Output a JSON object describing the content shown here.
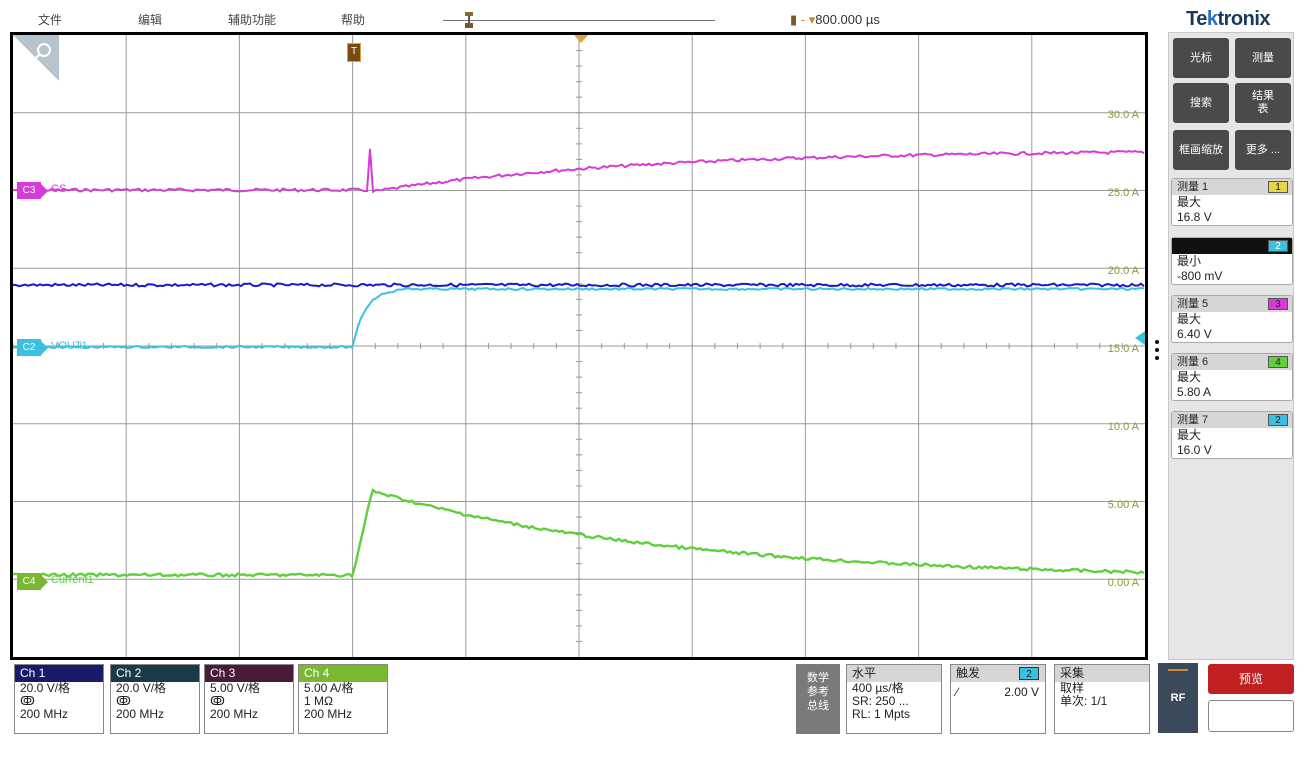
{
  "menu": {
    "file": "文件",
    "edit": "编辑",
    "utility": "辅助功能",
    "help": "帮助"
  },
  "trigger_position": {
    "label": "800.000 µs"
  },
  "waveform": {
    "y_tick_labels": [
      "30.0 A",
      "25.0 A",
      "20.0 A",
      "15.0 A",
      "10.0 A",
      "5.00 A",
      "0.00 A"
    ],
    "trigger_marker": "T",
    "channels": [
      {
        "id": "C3",
        "name": "CS",
        "color": "#d63bd6"
      },
      {
        "id": "C2",
        "name": "VOUT1",
        "color": "#3cc0e0"
      },
      {
        "id": "C4",
        "name": "Current1",
        "color": "#5fcf3e"
      }
    ],
    "trace_colors": {
      "ch1": "#1a1acc",
      "ch2": "#3cc0e0",
      "ch3": "#d63bd6",
      "ch4": "#5fcf3e"
    }
  },
  "right_panel": {
    "logo_pre": "Te",
    "logo_k": "k",
    "logo_post": "tronix",
    "buttons": {
      "cursor": "光标",
      "measure": "测量",
      "search": "搜索",
      "results_table_1": "结果",
      "results_table_2": "表",
      "zoom": "框画缩放",
      "more": "更多 ..."
    },
    "measurements": [
      {
        "title": "测量 1",
        "src": "1",
        "kind": "最大",
        "value": "16.8 V",
        "src_color": "#e8d64a"
      },
      {
        "title": "",
        "src": "2",
        "kind": "最小",
        "value": "-800 mV",
        "src_color": "#3cc0e0"
      },
      {
        "title": "测量 5",
        "src": "3",
        "kind": "最大",
        "value": "6.40 V",
        "src_color": "#d63bd6"
      },
      {
        "title": "测量 6",
        "src": "4",
        "kind": "最大",
        "value": "5.80 A",
        "src_color": "#5fcf3e"
      },
      {
        "title": "测量 7",
        "src": "2",
        "kind": "最大",
        "value": "16.0 V",
        "src_color": "#3cc0e0"
      }
    ]
  },
  "bottom": {
    "channels": [
      {
        "label": "Ch 1",
        "scale": "20.0 V/格",
        "coupling": "ↂ",
        "bw": "200 MHz",
        "color": "#1a1a6a"
      },
      {
        "label": "Ch 2",
        "scale": "20.0 V/格",
        "coupling": "ↂ",
        "bw": "200 MHz",
        "color": "#1a3a4a"
      },
      {
        "label": "Ch 3",
        "scale": "5.00 V/格",
        "coupling": "ↂ",
        "bw": "200 MHz",
        "color": "#4a1a3a"
      },
      {
        "label": "Ch 4",
        "scale": "5.00 A/格",
        "coupling": "1 MΩ",
        "bw": "200 MHz",
        "color": "#7ab832"
      }
    ],
    "math_ref_bus": [
      "数学",
      "参考",
      "总线"
    ],
    "horizontal": {
      "title": "水平",
      "scale": "400 µs/格",
      "sr": "SR: 250 ...",
      "rl": "RL: 1 Mpts"
    },
    "trigger": {
      "title": "触发",
      "source": "2",
      "slope": "∕",
      "level": "2.00 V"
    },
    "acquire": {
      "title": "采集",
      "mode": "取样",
      "count": "单次: 1/1"
    },
    "rf": "RF",
    "preview": "预览"
  }
}
